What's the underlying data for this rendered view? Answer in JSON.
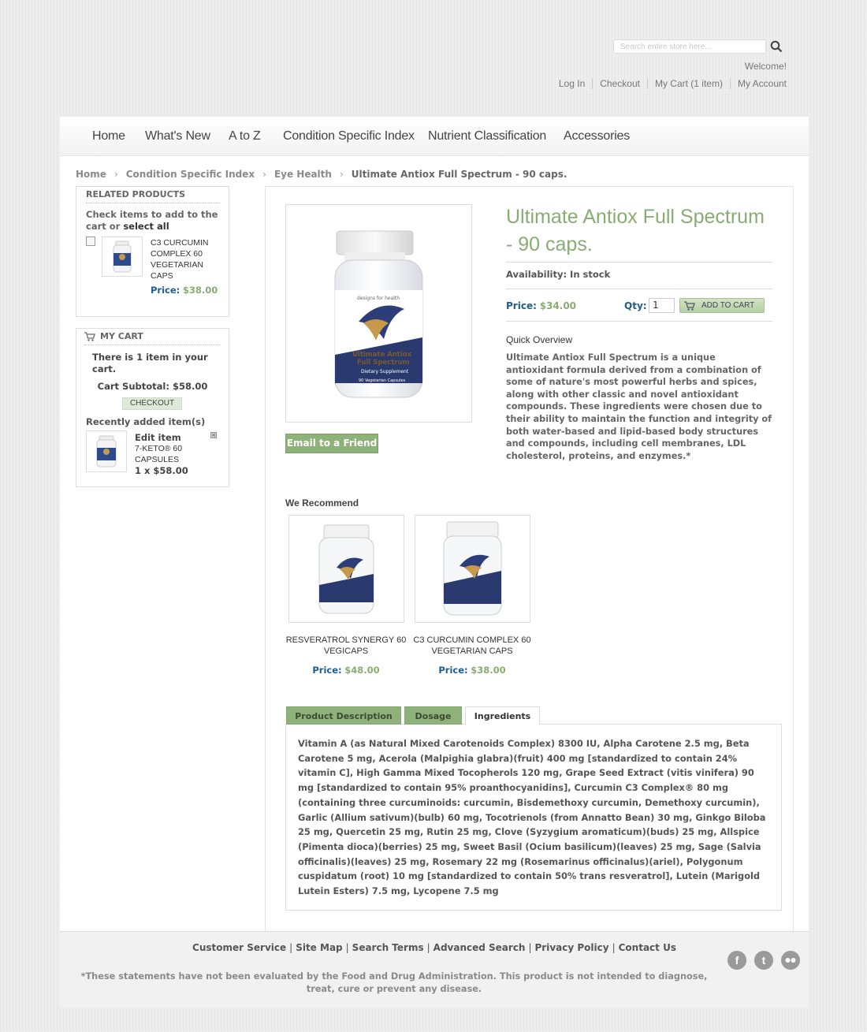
{
  "header": {
    "search_placeholder": "Search entire store here...",
    "welcome": "Welcome!",
    "links": [
      "Log In",
      "Checkout",
      "My Cart (1 item)",
      "My Account"
    ]
  },
  "nav": [
    "Home",
    "What's New",
    "A to Z",
    "Condition Specific Index",
    "Nutrient Classification",
    "Accessories"
  ],
  "breadcrumb": [
    "Home",
    "Condition Specific Index",
    "Eye Health",
    "Ultimate Antiox Full Spectrum - 90 caps."
  ],
  "related": {
    "title": "RELATED PRODUCTS",
    "instructions_prefix": "Check items to add to the cart or ",
    "select_all": "select all",
    "item": {
      "name": "C3 CURCUMIN COMPLEX 60 VEGETARIAN CAPS",
      "price_label": "Price:",
      "price": "$38.00"
    }
  },
  "cart": {
    "title": "MY CART",
    "summary": "There is 1 item in your cart.",
    "subtotal": "Cart Subtotal: $58.00",
    "checkout": "CHECKOUT",
    "recent_label": "Recently added item(s)",
    "item": {
      "edit": "Edit item",
      "name": "7-KETO® 60 CAPSULES",
      "qty": "1 x $58.00"
    }
  },
  "product": {
    "title": "Ultimate Antiox Full Spectrum - 90 caps.",
    "availability": "Availability: In stock",
    "price_label": "Price:",
    "price": "$34.00",
    "qty_label": "Qty:",
    "qty": "1",
    "add_to_cart": "ADD TO CART",
    "email_friend": "Email to a Friend",
    "overview_title": "Quick Overview",
    "overview": "Ultimate Antiox Full Spectrum is a unique antioxidant formula derived from a combination of some of nature's most powerful herbs and spices, along with other classic and novel antioxidant compounds. These ingredients were chosen due to their ability to maintain the function and integrity of both water-based and lipid-based body structures and compounds, including cell membranes, LDL cholesterol, proteins, and enzymes.*",
    "bottle_label": {
      "brand": "designs for health",
      "name1": "Ultimate Antiox",
      "name2": "Full Spectrum",
      "sub": "Dietary Supplement",
      "count": "90 Vegetarian Capsules"
    }
  },
  "recommend": {
    "title": "We Recommend",
    "items": [
      {
        "name": "RESVERATROL SYNERGY 60 VEGICAPS",
        "price_label": "Price:",
        "price": "$48.00"
      },
      {
        "name": "C3 CURCUMIN COMPLEX 60 VEGETARIAN CAPS",
        "price_label": "Price:",
        "price": "$38.00"
      }
    ]
  },
  "tabs": [
    "Product Description",
    "Dosage",
    "Ingredients"
  ],
  "ingredients": "Vitamin A (as Natural Mixed Carotenoids Complex) 8300 IU, Alpha Carotene 2.5 mg, Beta Carotene 5 mg, Acerola (Malpighia glabra)(fruit) 400 mg [standardized to contain 24% vitamin C], High Gamma Mixed Tocopherols 120 mg, Grape Seed Extract (vitis vinifera) 90 mg [standardized to contain 95% proanthocyanidins], Curcumin C3 Complex® 80 mg (containing three curcuminoids: curcumin, Bisdemethoxy curcumin, Demethoxy curcumin), Garlic (Allium sativum)(bulb) 60 mg, Tocotrienols (from Annatto Bean) 30 mg, Ginkgo Biloba 25 mg, Quercetin 25 mg, Rutin 25 mg, Clove (Syzygium aromaticum)(buds) 25 mg, Allspice (Pimenta dioca)(berries) 25 mg, Sweet Basil (Ocium basilicum)(leaves) 25 mg, Sage (Salvia officinalis)(leaves) 25 mg, Rosemary 22 mg (Rosemarinus officinalus)(ariel), Polygonum cuspidatum (root) 10 mg [standardized to contain 50% trans resveratrol], Lutein (Marigold Lutein Esters) 7.5 mg, Lycopene 7.5 mg",
  "footer": {
    "links": [
      "Customer Service",
      "Site Map",
      "Search Terms",
      "Advanced Search",
      "Privacy Policy",
      "Contact Us"
    ],
    "disclaimer": "*These statements have not been evaluated by the Food and Drug Administration. This product is not intended to diagnose, treat, cure or prevent any disease.",
    "social": [
      "facebook-icon",
      "twitter-icon",
      "flickr-icon"
    ]
  },
  "colors": {
    "accent_green": "#88ad72",
    "button_green": "#8fb27a",
    "price_blue": "#1e5d8c"
  }
}
